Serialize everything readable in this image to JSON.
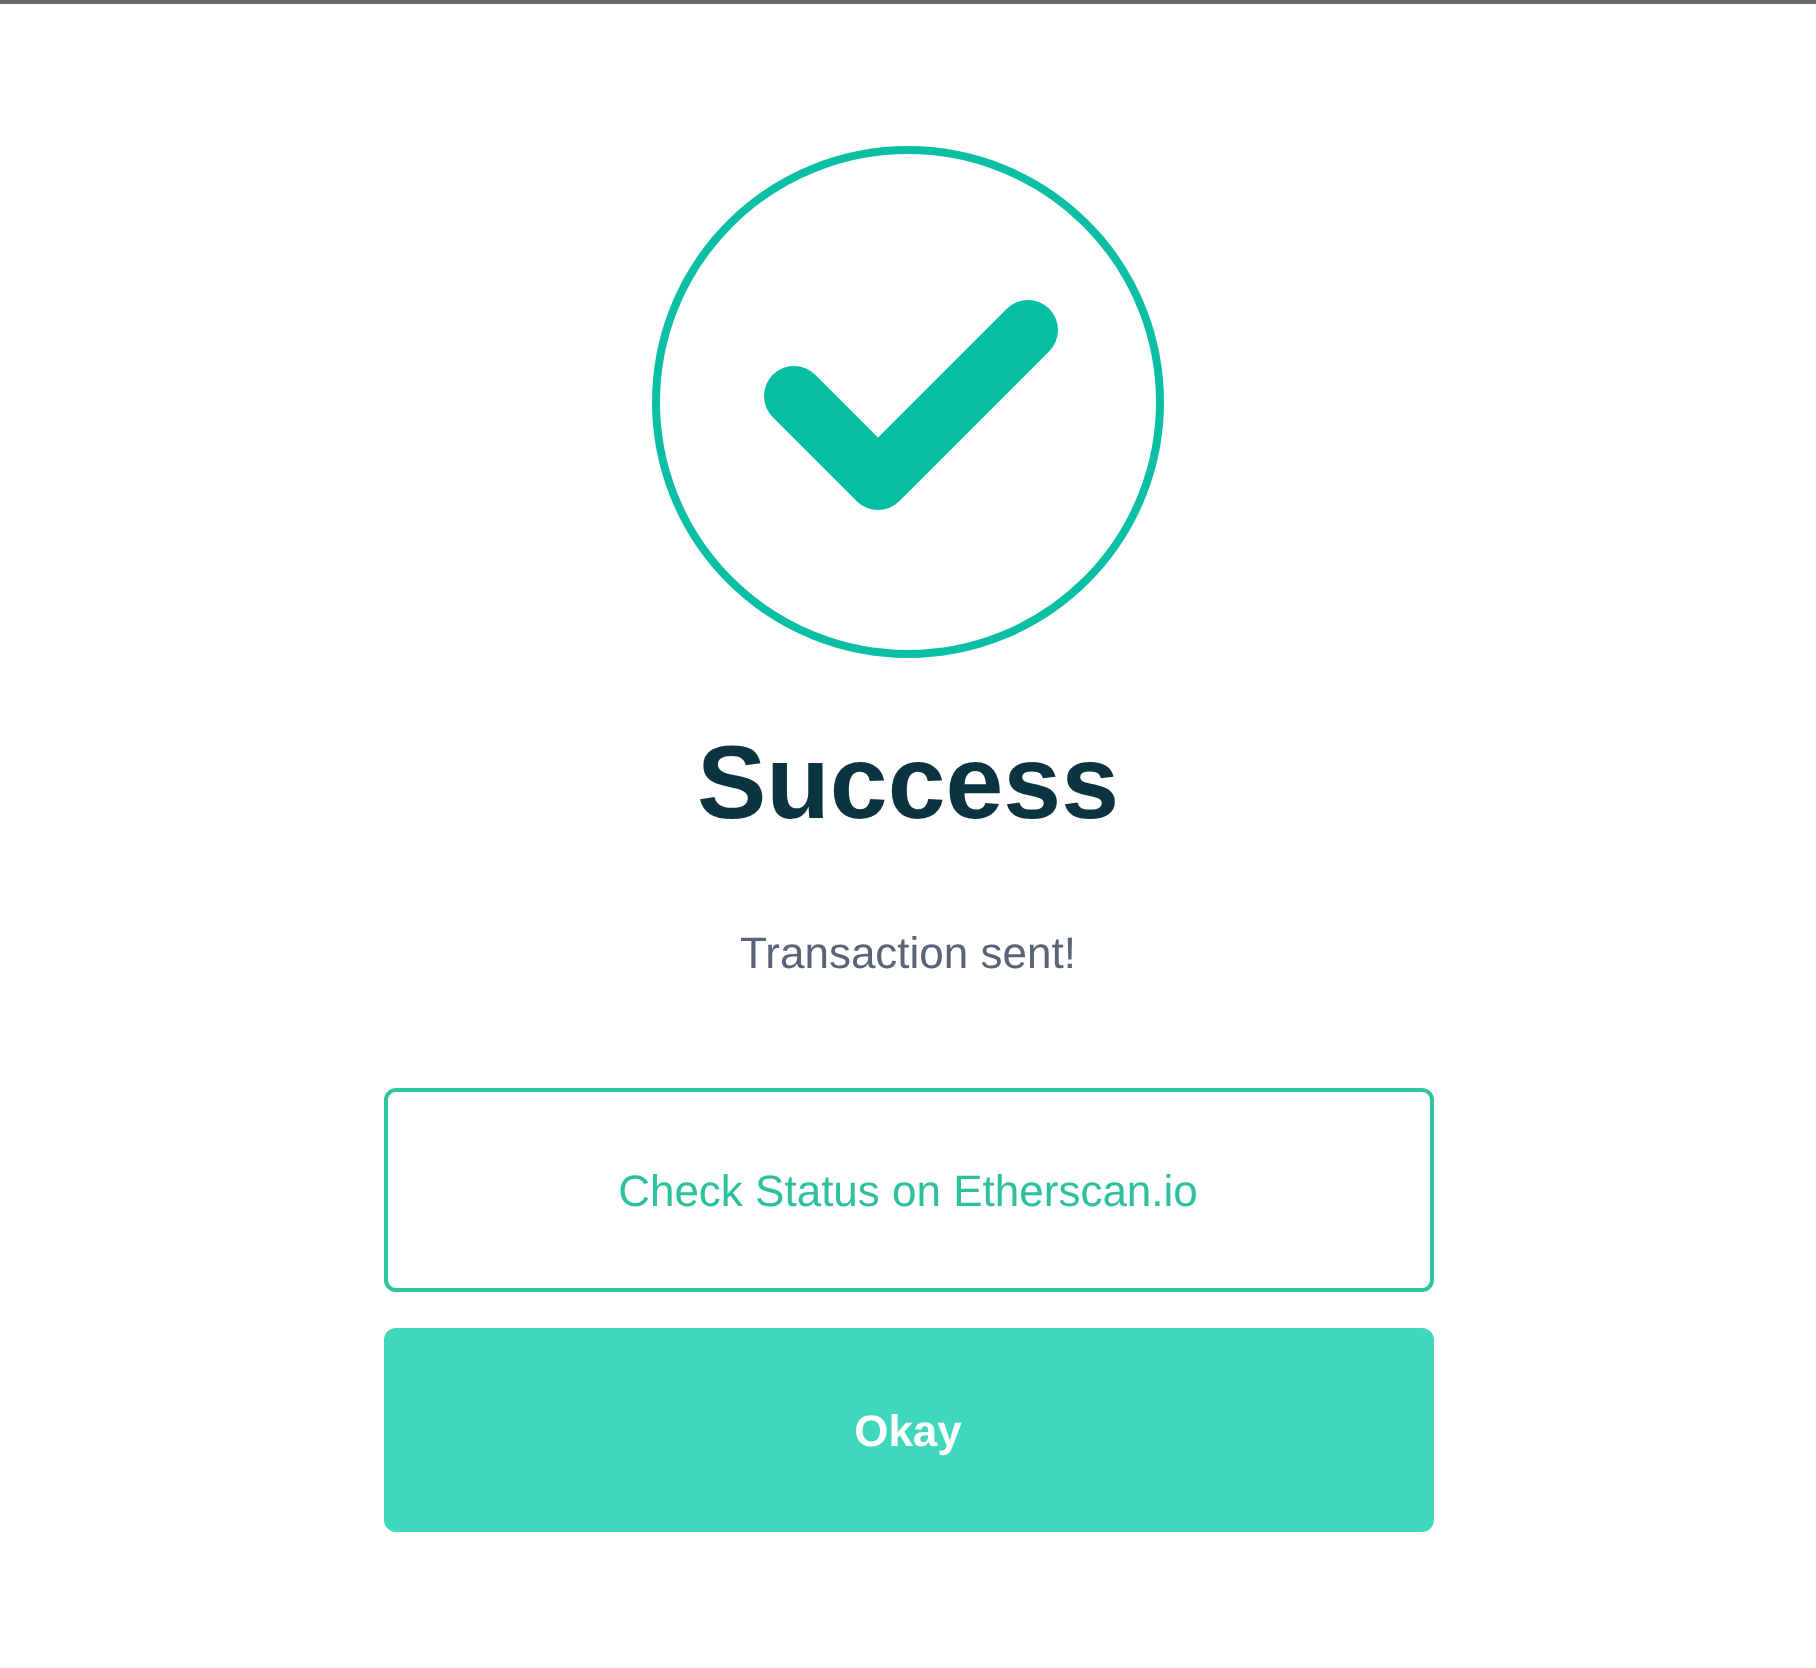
{
  "title": "Success",
  "message": "Transaction sent!",
  "buttons": [
    {
      "label": "Check Status on Etherscan.io",
      "kind": "outline"
    },
    {
      "label": "Okay",
      "kind": "filled"
    }
  ]
}
